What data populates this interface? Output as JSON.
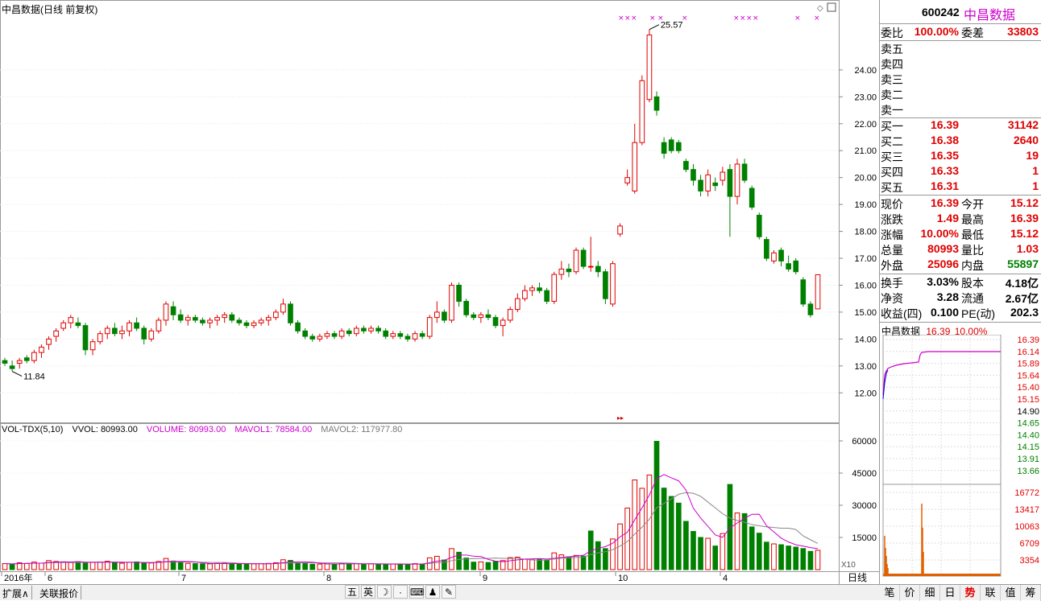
{
  "header": {
    "title": "中昌数据(日线 前复权)"
  },
  "stock": {
    "code": "600242",
    "name": "中昌数据"
  },
  "main_chart": {
    "price_ticks": [
      "24.00",
      "23.00",
      "22.00",
      "21.00",
      "20.00",
      "19.00",
      "18.00",
      "17.00",
      "16.00",
      "15.00",
      "14.00",
      "13.00",
      "12.00"
    ],
    "high_label": "25.57",
    "low_label": "11.84",
    "marker": "× ×  ×"
  },
  "volume": {
    "indicator": "VOL-TDX(5,10)",
    "vvol": "VVOL: 80993.00",
    "volume": "VOLUME: 80993.00",
    "mavol1": "MAVOL1: 78584.00",
    "mavol2": "MAVOL2: 117977.80",
    "ticks": [
      "60000",
      "45000",
      "30000",
      "15000"
    ],
    "scale": "X10"
  },
  "x_axis": {
    "labels": [
      {
        "t": "2016年"
      },
      {
        "t": "6"
      },
      {
        "t": "7"
      },
      {
        "t": "8"
      },
      {
        "t": "9"
      },
      {
        "t": "10"
      },
      {
        "t": "4"
      }
    ],
    "period": "日线"
  },
  "quote": {
    "weibi_label": "委比",
    "weibi": "100.00%",
    "weicha_label": "委差",
    "weicha": "33803",
    "sell": [
      {
        "label": "卖五",
        "price": "",
        "vol": ""
      },
      {
        "label": "卖四",
        "price": "",
        "vol": ""
      },
      {
        "label": "卖三",
        "price": "",
        "vol": ""
      },
      {
        "label": "卖二",
        "price": "",
        "vol": ""
      },
      {
        "label": "卖一",
        "price": "",
        "vol": ""
      }
    ],
    "buy": [
      {
        "label": "买一",
        "price": "16.39",
        "vol": "31142"
      },
      {
        "label": "买二",
        "price": "16.38",
        "vol": "2640"
      },
      {
        "label": "买三",
        "price": "16.35",
        "vol": "19"
      },
      {
        "label": "买四",
        "price": "16.33",
        "vol": "1"
      },
      {
        "label": "买五",
        "price": "16.31",
        "vol": "1"
      }
    ],
    "stats": [
      {
        "l1": "现价",
        "v1": "16.39",
        "l2": "今开",
        "v2": "15.12",
        "c1": "red",
        "c2": "red"
      },
      {
        "l1": "涨跌",
        "v1": "1.49",
        "l2": "最高",
        "v2": "16.39",
        "c1": "red",
        "c2": "red"
      },
      {
        "l1": "涨幅",
        "v1": "10.00%",
        "l2": "最低",
        "v2": "15.12",
        "c1": "red",
        "c2": "red"
      },
      {
        "l1": "总量",
        "v1": "80993",
        "l2": "量比",
        "v2": "1.03",
        "c1": "red",
        "c2": "red"
      },
      {
        "l1": "外盘",
        "v1": "25096",
        "l2": "内盘",
        "v2": "55897",
        "c1": "red",
        "c2": "green"
      }
    ],
    "stats2": [
      {
        "l1": "换手",
        "v1": "3.03%",
        "l2": "股本",
        "v2": "4.18亿"
      },
      {
        "l1": "净资",
        "v1": "3.28",
        "l2": "流通",
        "v2": "2.67亿"
      },
      {
        "l1": "收益(四)",
        "v1": "0.100",
        "l2": "PE(动)",
        "v2": "202.3"
      }
    ]
  },
  "mini": {
    "name": "中昌数据",
    "price": "16.39",
    "pct": "10.00%",
    "price_ticks": [
      "16.39",
      "16.14",
      "15.89",
      "15.64",
      "15.40",
      "15.15",
      "14.90",
      "14.65",
      "14.40",
      "14.15",
      "13.91",
      "13.66"
    ],
    "vol_ticks": [
      "16772",
      "13417",
      "10063",
      "6709",
      "3354"
    ]
  },
  "bottom_tabs": [
    "扩展",
    "关联报价"
  ],
  "toolbar": {
    "ime": "五",
    "lang": "英"
  },
  "right_tabs": [
    "笔",
    "价",
    "细",
    "日",
    "势",
    "联",
    "值",
    "筹"
  ],
  "colors": {
    "up": "#e00000",
    "down": "#008000",
    "mavol1": "#cc00cc",
    "mavol2": "#888888",
    "text_red": "#e00000",
    "text_green": "#008000"
  },
  "chart_data": {
    "type": "candlestick",
    "title": "中昌数据(日线 前复权)",
    "y_range": [
      11.5,
      26.0
    ],
    "annotations": [
      {
        "label": "25.57",
        "type": "high"
      },
      {
        "label": "11.84",
        "type": "low"
      }
    ],
    "candles": [
      [
        13.2,
        13.3,
        13.0,
        13.1
      ],
      [
        13.0,
        13.2,
        12.8,
        12.9
      ],
      [
        13.1,
        13.3,
        12.9,
        13.2
      ],
      [
        13.3,
        13.4,
        13.1,
        13.2
      ],
      [
        13.2,
        13.6,
        13.1,
        13.5
      ],
      [
        13.5,
        13.8,
        13.3,
        13.7
      ],
      [
        13.8,
        14.1,
        13.6,
        14.0
      ],
      [
        14.1,
        14.4,
        13.9,
        14.3
      ],
      [
        14.4,
        14.7,
        14.3,
        14.6
      ],
      [
        14.6,
        14.9,
        14.4,
        14.8
      ],
      [
        14.6,
        14.8,
        14.4,
        14.5
      ],
      [
        14.5,
        14.6,
        13.4,
        13.6
      ],
      [
        13.6,
        14.0,
        13.4,
        13.9
      ],
      [
        13.9,
        14.3,
        13.8,
        14.2
      ],
      [
        14.2,
        14.5,
        14.0,
        14.4
      ],
      [
        14.4,
        14.6,
        14.1,
        14.2
      ],
      [
        14.2,
        14.5,
        14.0,
        14.3
      ],
      [
        14.3,
        14.7,
        14.1,
        14.6
      ],
      [
        14.6,
        14.8,
        14.3,
        14.4
      ],
      [
        14.4,
        14.5,
        13.8,
        14.0
      ],
      [
        14.0,
        14.4,
        13.9,
        14.3
      ],
      [
        14.3,
        14.8,
        14.2,
        14.7
      ],
      [
        14.7,
        15.4,
        14.5,
        15.3
      ],
      [
        15.2,
        15.4,
        14.7,
        14.9
      ],
      [
        14.9,
        15.1,
        14.6,
        14.7
      ],
      [
        14.7,
        14.9,
        14.5,
        14.8
      ],
      [
        14.8,
        14.9,
        14.6,
        14.7
      ],
      [
        14.7,
        14.8,
        14.5,
        14.6
      ],
      [
        14.6,
        14.8,
        14.4,
        14.7
      ],
      [
        14.7,
        14.9,
        14.5,
        14.8
      ],
      [
        14.8,
        15.0,
        14.6,
        14.9
      ],
      [
        14.9,
        15.0,
        14.6,
        14.7
      ],
      [
        14.7,
        14.8,
        14.5,
        14.6
      ],
      [
        14.6,
        14.7,
        14.4,
        14.5
      ],
      [
        14.5,
        14.7,
        14.4,
        14.6
      ],
      [
        14.6,
        14.8,
        14.5,
        14.7
      ],
      [
        14.7,
        14.9,
        14.5,
        14.8
      ],
      [
        14.8,
        15.1,
        14.7,
        15.0
      ],
      [
        15.0,
        15.5,
        14.9,
        15.3
      ],
      [
        15.3,
        15.4,
        14.5,
        14.6
      ],
      [
        14.6,
        14.7,
        14.2,
        14.3
      ],
      [
        14.3,
        14.4,
        14.0,
        14.1
      ],
      [
        14.1,
        14.2,
        13.9,
        14.0
      ],
      [
        14.0,
        14.2,
        13.9,
        14.1
      ],
      [
        14.1,
        14.3,
        14.0,
        14.2
      ],
      [
        14.2,
        14.3,
        14.0,
        14.1
      ],
      [
        14.1,
        14.4,
        14.0,
        14.3
      ],
      [
        14.3,
        14.4,
        14.1,
        14.2
      ],
      [
        14.2,
        14.5,
        14.1,
        14.4
      ],
      [
        14.4,
        14.5,
        14.2,
        14.3
      ],
      [
        14.3,
        14.5,
        14.2,
        14.4
      ],
      [
        14.4,
        14.5,
        14.2,
        14.3
      ],
      [
        14.3,
        14.4,
        14.0,
        14.1
      ],
      [
        14.1,
        14.3,
        14.0,
        14.2
      ],
      [
        14.2,
        14.3,
        14.0,
        14.1
      ],
      [
        14.1,
        14.2,
        13.9,
        14.0
      ],
      [
        14.0,
        14.3,
        13.9,
        14.2
      ],
      [
        14.2,
        14.3,
        14.0,
        14.1
      ],
      [
        14.1,
        14.9,
        14.0,
        14.8
      ],
      [
        14.8,
        15.4,
        14.6,
        15.0
      ],
      [
        15.0,
        15.1,
        14.6,
        14.7
      ],
      [
        14.7,
        16.1,
        14.6,
        16.0
      ],
      [
        16.0,
        16.1,
        15.2,
        15.4
      ],
      [
        15.4,
        15.5,
        14.8,
        14.9
      ],
      [
        14.9,
        15.0,
        14.7,
        14.8
      ],
      [
        14.8,
        15.0,
        14.6,
        14.9
      ],
      [
        14.9,
        15.1,
        14.7,
        14.8
      ],
      [
        14.8,
        14.9,
        14.4,
        14.5
      ],
      [
        14.5,
        14.8,
        14.1,
        14.7
      ],
      [
        14.7,
        15.2,
        14.6,
        15.1
      ],
      [
        15.1,
        15.7,
        15.0,
        15.5
      ],
      [
        15.5,
        16.0,
        15.4,
        15.8
      ],
      [
        15.8,
        16.0,
        15.6,
        15.9
      ],
      [
        15.9,
        16.1,
        15.7,
        15.8
      ],
      [
        15.8,
        15.9,
        15.3,
        15.4
      ],
      [
        15.4,
        16.5,
        15.3,
        16.4
      ],
      [
        16.4,
        16.9,
        16.2,
        16.6
      ],
      [
        16.6,
        16.8,
        16.3,
        16.5
      ],
      [
        16.5,
        17.4,
        16.4,
        17.3
      ],
      [
        17.3,
        17.4,
        16.6,
        16.7
      ],
      [
        16.7,
        17.8,
        16.5,
        16.7
      ],
      [
        16.7,
        16.9,
        16.3,
        16.5
      ],
      [
        16.5,
        16.6,
        15.3,
        15.5
      ],
      [
        15.3,
        16.9,
        15.2,
        16.8
      ],
      [
        17.9,
        18.3,
        17.8,
        18.2
      ],
      [
        19.8,
        20.3,
        19.7,
        20.0
      ],
      [
        19.5,
        22.0,
        19.4,
        21.3
      ],
      [
        21.3,
        23.8,
        21.2,
        23.6
      ],
      [
        22.9,
        25.5,
        22.8,
        25.3
      ],
      [
        23.0,
        23.2,
        22.3,
        22.5
      ],
      [
        21.3,
        21.5,
        20.7,
        20.9
      ],
      [
        21.4,
        21.5,
        20.9,
        21.0
      ],
      [
        21.3,
        21.4,
        20.9,
        21.0
      ],
      [
        20.6,
        20.7,
        20.2,
        20.3
      ],
      [
        20.3,
        20.5,
        19.7,
        19.9
      ],
      [
        19.9,
        20.1,
        19.3,
        19.5
      ],
      [
        19.5,
        20.3,
        19.3,
        20.1
      ],
      [
        19.8,
        20.0,
        19.5,
        19.7
      ],
      [
        19.9,
        20.4,
        19.7,
        20.2
      ],
      [
        20.3,
        20.5,
        17.8,
        19.3
      ],
      [
        19.3,
        20.7,
        19.0,
        20.5
      ],
      [
        20.5,
        20.7,
        19.8,
        19.9
      ],
      [
        19.6,
        19.7,
        18.8,
        18.9
      ],
      [
        18.6,
        18.7,
        17.7,
        17.8
      ],
      [
        17.7,
        17.8,
        16.9,
        17.0
      ],
      [
        16.9,
        17.3,
        16.8,
        17.2
      ],
      [
        17.3,
        17.4,
        16.7,
        16.9
      ],
      [
        16.8,
        17.1,
        16.5,
        16.6
      ],
      [
        16.9,
        17.0,
        16.4,
        16.5
      ],
      [
        16.2,
        16.3,
        15.2,
        15.3
      ],
      [
        15.3,
        15.4,
        14.8,
        14.9
      ],
      [
        15.12,
        16.39,
        15.12,
        16.39
      ]
    ],
    "volume_max": 60000,
    "volumes": [
      2800,
      2500,
      3200,
      2900,
      3500,
      3000,
      4200,
      3800,
      3600,
      3300,
      3700,
      3100,
      3400,
      3500,
      3900,
      3200,
      3000,
      3400,
      3600,
      3000,
      3100,
      3800,
      5200,
      4000,
      3200,
      2900,
      2800,
      2700,
      2700,
      2900,
      3000,
      2800,
      2700,
      2600,
      2700,
      2800,
      2900,
      3200,
      4600,
      4300,
      3100,
      2800,
      2500,
      2600,
      2700,
      2600,
      2900,
      2700,
      2800,
      2600,
      2700,
      2600,
      2500,
      2600,
      2500,
      2500,
      2800,
      2600,
      5500,
      6200,
      4500,
      9800,
      8100,
      5400,
      3500,
      3600,
      3300,
      3900,
      4200,
      5600,
      5800,
      4900,
      4600,
      4800,
      4500,
      7800,
      6900,
      5900,
      6600,
      6300,
      18000,
      13000,
      9800,
      14300,
      21300,
      28700,
      41800,
      37900,
      44100,
      59800,
      38000,
      34100,
      31000,
      22500,
      17800,
      15000,
      14600,
      11000,
      16800,
      39700,
      26400,
      26100,
      19900,
      17000,
      12800,
      12000,
      11600,
      11000,
      10500,
      9800,
      8500,
      9000
    ],
    "vol_up": [
      1,
      0,
      1,
      1,
      1,
      1,
      1,
      1,
      1,
      1,
      0,
      0,
      1,
      1,
      1,
      0,
      1,
      1,
      0,
      0,
      1,
      1,
      1,
      0,
      0,
      1,
      0,
      0,
      1,
      1,
      1,
      0,
      0,
      0,
      1,
      1,
      1,
      1,
      1,
      0,
      0,
      0,
      0,
      1,
      1,
      0,
      1,
      0,
      1,
      0,
      1,
      0,
      0,
      1,
      0,
      0,
      1,
      0,
      1,
      1,
      0,
      1,
      0,
      0,
      0,
      1,
      0,
      0,
      1,
      1,
      1,
      1,
      1,
      0,
      0,
      1,
      1,
      0,
      1,
      0,
      0,
      0,
      0,
      1,
      1,
      1,
      1,
      1,
      1,
      0,
      0,
      0,
      0,
      0,
      0,
      0,
      1,
      0,
      1,
      0,
      1,
      0,
      0,
      0,
      0,
      1,
      0,
      0,
      0,
      0,
      0,
      1
    ]
  }
}
